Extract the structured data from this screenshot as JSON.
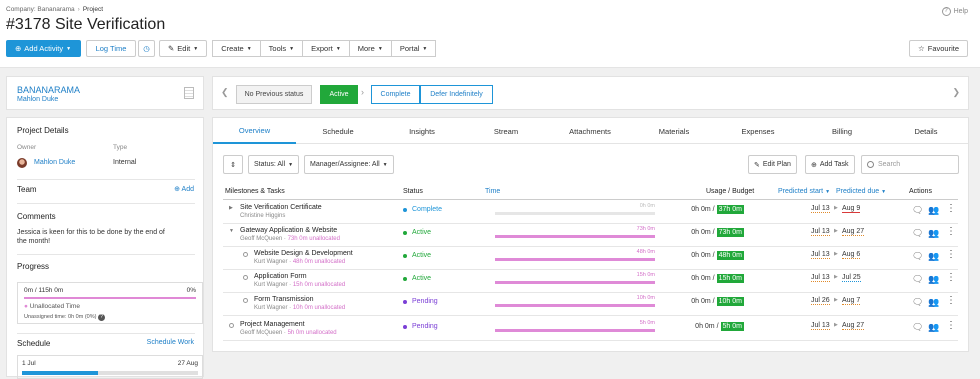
{
  "breadcrumb": {
    "company": "Company: Bananarama",
    "project": "Project"
  },
  "help": "Help",
  "title": "#3178 Site Verification",
  "toolbar": {
    "add_activity": "Add Activity",
    "log_time": "Log Time",
    "edit": "Edit",
    "menu": [
      "Create",
      "Tools",
      "Export",
      "More",
      "Portal"
    ],
    "favourite": "Favourite"
  },
  "client": {
    "name": "BANANARAMA",
    "contact": "Mahlon Duke"
  },
  "statusbar": {
    "previous": "No Previous status",
    "active": "Active",
    "complete": "Complete",
    "defer": "Defer Indefinitely"
  },
  "details": {
    "heading": "Project Details",
    "owner_label": "Owner",
    "type_label": "Type",
    "owner": "Mahlon Duke",
    "type": "Internal",
    "team": "Team",
    "add": "Add",
    "comments": "Comments",
    "comment_text_1": "Jessica is keen for this to be done by the end of",
    "comment_text_2": "the month!",
    "progress": "Progress",
    "progress_hours": "0m / 115h 0m",
    "progress_pct": "0%",
    "progress_fill": 1.0,
    "unallocated": "Unallocated Time",
    "unassigned": "Unassigned time: 0h 0m (0%)",
    "schedule": "Schedule",
    "schedule_work": "Schedule Work",
    "sched_start": "1 Jul",
    "sched_end": "27 Aug",
    "sched_fill": 0.43
  },
  "tabs": [
    "Overview",
    "Schedule",
    "Insights",
    "Stream",
    "Attachments",
    "Materials",
    "Expenses",
    "Billing",
    "Details"
  ],
  "filters": {
    "status": "Status: All",
    "manager": "Manager/Assignee: All",
    "edit_plan": "Edit Plan",
    "add_task": "Add Task",
    "search_placeholder": "Search"
  },
  "columns": {
    "name": "Milestones & Tasks",
    "status": "Status",
    "time": "Time",
    "usage": "Usage / Budget",
    "pstart": "Predicted start",
    "pdue": "Predicted due",
    "actions": "Actions"
  },
  "rows": [
    {
      "name": "Site Verification Certificate",
      "owner": "Christine Higgins",
      "unalloc": "",
      "status": "Complete",
      "status_color": "#1e95d8",
      "time_label": "0h 0m",
      "time_fill": 0,
      "used": "0h 0m /",
      "budget": "37h 0m",
      "start": "Jul 13",
      "due": "Aug 9"
    },
    {
      "name": "Gateway Application & Website",
      "owner": "Geoff McQueen",
      "unalloc": "73h 0m unallocated",
      "status": "Active",
      "status_color": "#21a83a",
      "time_label": "73h 0m",
      "time_fill": 1,
      "used": "0h 0m /",
      "budget": "73h 0m",
      "start": "Jul 13",
      "due": "Aug 27"
    },
    {
      "name": "Website Design & Development",
      "owner": "Kurt Wagner",
      "unalloc": "48h 0m unallocated",
      "status": "Active",
      "status_color": "#21a83a",
      "time_label": "48h 0m",
      "time_fill": 1,
      "used": "0h 0m /",
      "budget": "48h 0m",
      "start": "Jul 13",
      "due": "Aug 6"
    },
    {
      "name": "Application Form",
      "owner": "Kurt Wagner",
      "unalloc": "15h 0m unallocated",
      "status": "Active",
      "status_color": "#21a83a",
      "time_label": "15h 0m",
      "time_fill": 1,
      "used": "0h 0m /",
      "budget": "15h 0m",
      "start": "Jul 13",
      "due": "Jul 25"
    },
    {
      "name": "Form Transmission",
      "owner": "Kurt Wagner",
      "unalloc": "10h 0m unallocated",
      "status": "Pending",
      "status_color": "#7b3fd6",
      "time_label": "10h 0m",
      "time_fill": 1,
      "used": "0h 0m /",
      "budget": "10h 0m",
      "start": "Jul 26",
      "due": "Aug 7"
    },
    {
      "name": "Project Management",
      "owner": "Geoff McQueen",
      "unalloc": "5h 0m unallocated",
      "status": "Pending",
      "status_color": "#7b3fd6",
      "time_label": "5h 0m",
      "time_fill": 1,
      "used": "0h 0m /",
      "budget": "5h 0m",
      "start": "Jul 13",
      "due": "Aug 27"
    }
  ]
}
